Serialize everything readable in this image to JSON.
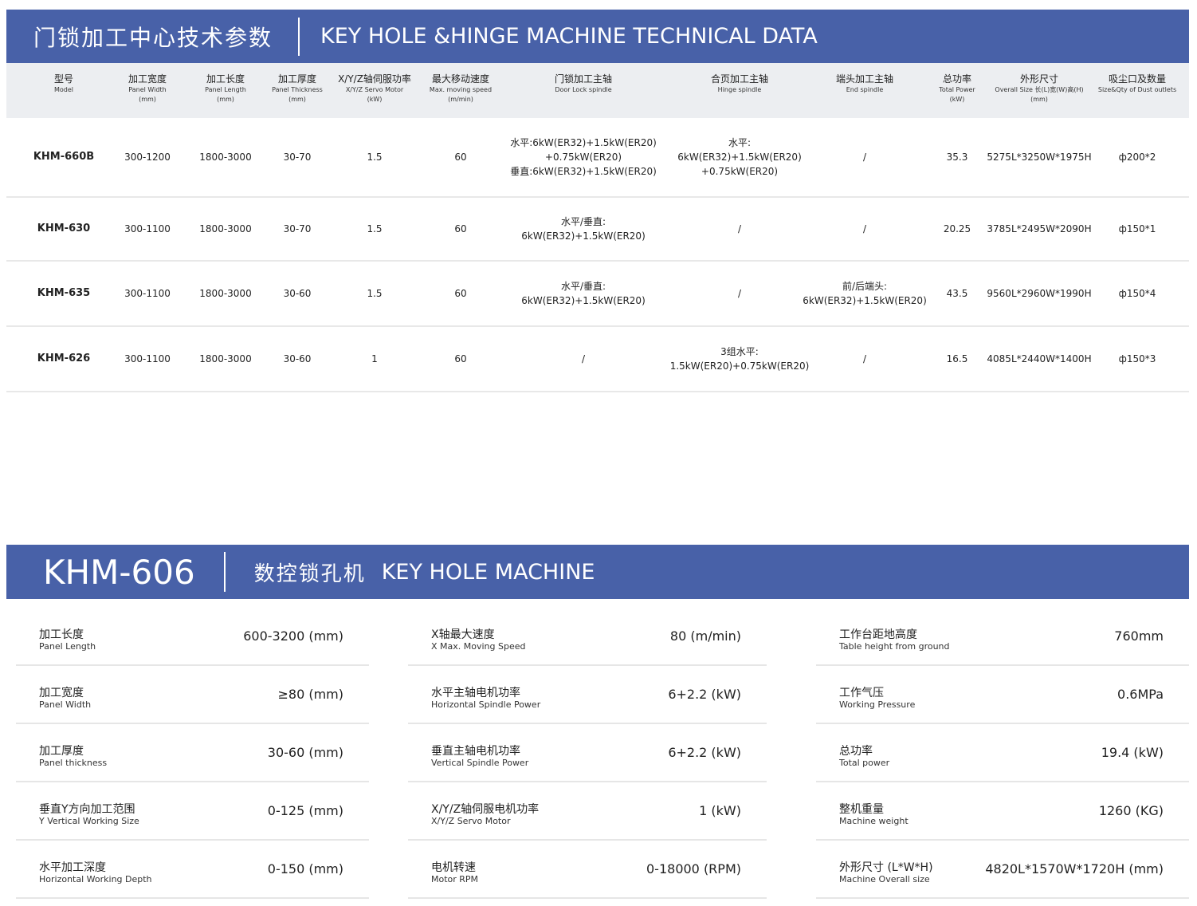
{
  "banner1": {
    "zh": "门锁加工中心技术参数",
    "en": "KEY HOLE &HINGE MACHINE TECHNICAL DATA"
  },
  "table": {
    "headers": [
      {
        "zh": "型号",
        "en": "Model",
        "en2": ""
      },
      {
        "zh": "加工宽度",
        "en": "Panel Width",
        "en2": "(mm)"
      },
      {
        "zh": "加工长度",
        "en": "Panel Length",
        "en2": "(mm)"
      },
      {
        "zh": "加工厚度",
        "en": "Panel Thickness",
        "en2": "(mm)"
      },
      {
        "zh": "X/Y/Z轴伺服功率",
        "en": "X/Y/Z Servo Motor",
        "en2": "(kW)"
      },
      {
        "zh": "最大移动速度",
        "en": "Max. moving speed",
        "en2": "(m/min)"
      },
      {
        "zh": "门锁加工主轴",
        "en": "Door Lock spindle",
        "en2": ""
      },
      {
        "zh": "合页加工主轴",
        "en": "Hinge spindle",
        "en2": ""
      },
      {
        "zh": "端头加工主轴",
        "en": "End spindle",
        "en2": ""
      },
      {
        "zh": "总功率",
        "en": "Total Power",
        "en2": "(kW)"
      },
      {
        "zh": "外形尺寸",
        "en": "Overall Size 长(L)宽(W)高(H)",
        "en2": "(mm)"
      },
      {
        "zh": "吸尘口及数量",
        "en": "Size&Qty of Dust outlets",
        "en2": ""
      }
    ],
    "rows": [
      {
        "model": "KHM-660B",
        "width": "300-1200",
        "length": "1800-3000",
        "thickness": "30-70",
        "servo": "1.5",
        "speed": "60",
        "door": [
          "水平:6kW(ER32)+1.5kW(ER20)",
          "+0.75kW(ER20)",
          "垂直:6kW(ER32)+1.5kW(ER20)"
        ],
        "hinge": [
          "水平:",
          "6kW(ER32)+1.5kW(ER20)",
          "+0.75kW(ER20)"
        ],
        "end": [
          "/"
        ],
        "power": "35.3",
        "size": "5275L*3250W*1975H",
        "dust": "ф200*2"
      },
      {
        "model": "KHM-630",
        "width": "300-1100",
        "length": "1800-3000",
        "thickness": "30-70",
        "servo": "1.5",
        "speed": "60",
        "door": [
          "水平/垂直:",
          "6kW(ER32)+1.5kW(ER20)"
        ],
        "hinge": [
          "/"
        ],
        "end": [
          "/"
        ],
        "power": "20.25",
        "size": "3785L*2495W*2090H",
        "dust": "ф150*1"
      },
      {
        "model": "KHM-635",
        "width": "300-1100",
        "length": "1800-3000",
        "thickness": "30-60",
        "servo": "1.5",
        "speed": "60",
        "door": [
          "水平/垂直:",
          "6kW(ER32)+1.5kW(ER20)"
        ],
        "hinge": [
          "/"
        ],
        "end": [
          "前/后端头:",
          "6kW(ER32)+1.5kW(ER20)"
        ],
        "power": "43.5",
        "size": "9560L*2960W*1990H",
        "dust": "ф150*4"
      },
      {
        "model": "KHM-626",
        "width": "300-1100",
        "length": "1800-3000",
        "thickness": "30-60",
        "servo": "1",
        "speed": "60",
        "door": [
          "/"
        ],
        "hinge": [
          "3组水平:",
          "1.5kW(ER20)+0.75kW(ER20)"
        ],
        "end": [
          "/"
        ],
        "power": "16.5",
        "size": "4085L*2440W*1400H",
        "dust": "ф150*3"
      }
    ]
  },
  "banner2": {
    "model": "KHM-606",
    "zh": "数控锁孔机",
    "en": "KEY HOLE MACHINE"
  },
  "specs": [
    [
      {
        "zh": "加工长度",
        "en": "Panel Length",
        "value": "600-3200 (mm)"
      },
      {
        "zh": "加工宽度",
        "en": "Panel Width",
        "value": "≥80 (mm)"
      },
      {
        "zh": "加工厚度",
        "en": "Panel thickness",
        "value": "30-60 (mm)"
      },
      {
        "zh": "垂直Y方向加工范围",
        "en": "Y Vertical Working Size",
        "value": "0-125 (mm)"
      },
      {
        "zh": "水平加工深度",
        "en": "Horizontal Working Depth",
        "value": "0-150  (mm)"
      }
    ],
    [
      {
        "zh": "X轴最大速度",
        "en": "X Max. Moving Speed",
        "value": "80 (m/min)"
      },
      {
        "zh": "水平主轴电机功率",
        "en": "Horizontal Spindle Power",
        "value": "6+2.2 (kW)"
      },
      {
        "zh": "垂直主轴电机功率",
        "en": "Vertical Spindle Power",
        "value": "6+2.2 (kW)"
      },
      {
        "zh": "X/Y/Z轴伺服电机功率",
        "en": "X/Y/Z Servo Motor",
        "value": "1 (kW)"
      },
      {
        "zh": "电机转速",
        "en": "Motor RPM",
        "value": "0-18000  (RPM)"
      }
    ],
    [
      {
        "zh": "工作台距地高度",
        "en": "Table height from ground",
        "value": "760mm"
      },
      {
        "zh": "工作气压",
        "en": "Working Pressure",
        "value": "0.6MPa"
      },
      {
        "zh": "总功率",
        "en": "Total power",
        "value": "19.4 (kW)"
      },
      {
        "zh": "整机重量",
        "en": "Machine weight",
        "value": "1260 (KG)"
      },
      {
        "zh": "外形尺寸 (L*W*H)",
        "en": "Machine Overall size",
        "value": "4820L*1570W*1720H (mm)"
      }
    ]
  ]
}
